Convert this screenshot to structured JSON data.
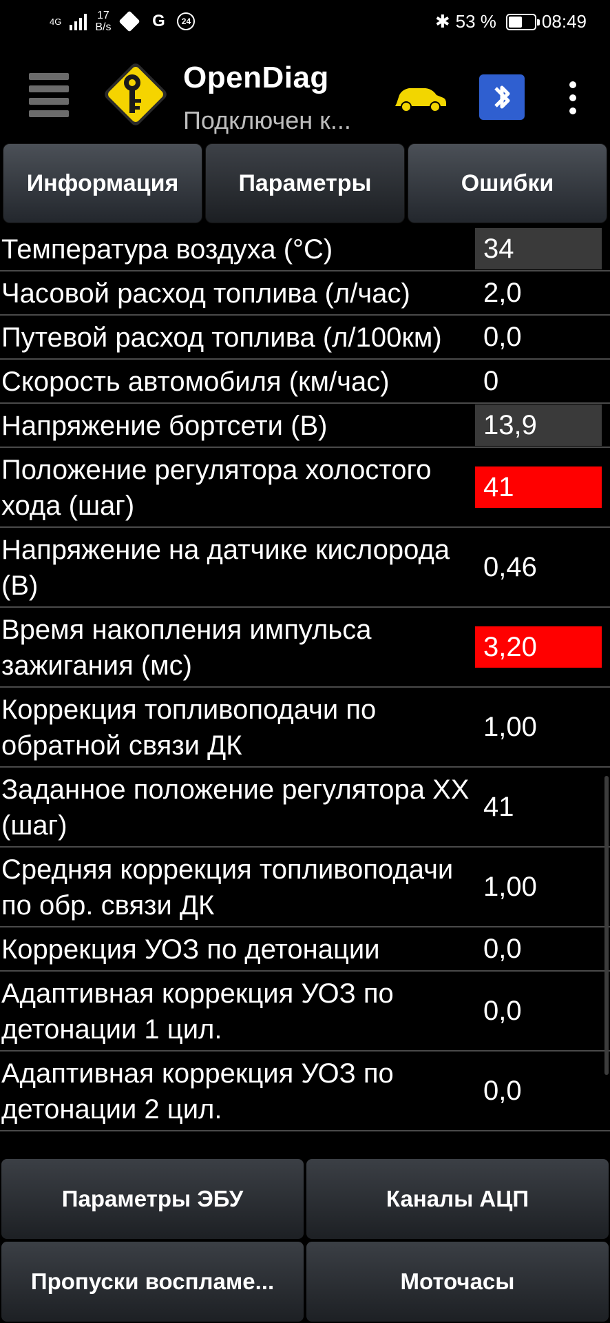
{
  "status_bar": {
    "network": "4G",
    "speed_value": "17",
    "speed_unit": "B/s",
    "g_label": "G",
    "badge": "24",
    "battery": "53 %",
    "battery_level": 0.53,
    "time": "08:49"
  },
  "app_bar": {
    "title": "OpenDiag",
    "subtitle": "Подключен к..."
  },
  "tabs": [
    {
      "label": "Информация"
    },
    {
      "label": "Параметры"
    },
    {
      "label": "Ошибки"
    }
  ],
  "params": [
    {
      "name": "Температура воздуха (°C)",
      "value": "34",
      "highlight": "gray"
    },
    {
      "name": "Часовой расход топлива (л/час)",
      "value": "2,0",
      "highlight": "none"
    },
    {
      "name": "Путевой расход топлива (л/100км)",
      "value": "0,0",
      "highlight": "none"
    },
    {
      "name": "Скорость автомобиля (км/час)",
      "value": "0",
      "highlight": "none"
    },
    {
      "name": "Напряжение бортсети (В)",
      "value": "13,9",
      "highlight": "gray"
    },
    {
      "name": "Положение регулятора холостого хода (шаг)",
      "value": "41",
      "highlight": "red"
    },
    {
      "name": "Напряжение на датчике кислорода (В)",
      "value": "0,46",
      "highlight": "none"
    },
    {
      "name": "Время накопления импульса зажигания (мс)",
      "value": "3,20",
      "highlight": "red"
    },
    {
      "name": "Коррекция топливоподачи по обратной связи ДК",
      "value": "1,00",
      "highlight": "none"
    },
    {
      "name": "Заданное положение регулятора ХХ (шаг)",
      "value": "41",
      "highlight": "none"
    },
    {
      "name": "Средняя коррекция топливоподачи по обр. связи ДК",
      "value": "1,00",
      "highlight": "none"
    },
    {
      "name": "Коррекция УОЗ по детонации",
      "value": "0,0",
      "highlight": "none"
    },
    {
      "name": "Адаптивная коррекция УОЗ по детонации 1 цил.",
      "value": "0,0",
      "highlight": "none"
    },
    {
      "name": "Адаптивная коррекция УОЗ по детонации 2 цил.",
      "value": "0,0",
      "highlight": "none"
    }
  ],
  "bottom_buttons": [
    {
      "label": "Параметры ЭБУ"
    },
    {
      "label": "Каналы АЦП"
    },
    {
      "label": "Пропуски воспламе..."
    },
    {
      "label": "Моточасы"
    }
  ],
  "colors": {
    "red_highlight": "#ff0000",
    "gray_highlight": "#3a3a3a",
    "logo_yellow": "#f5d400",
    "car_yellow": "#f2d600",
    "bt_blue": "#2f5fd0"
  }
}
